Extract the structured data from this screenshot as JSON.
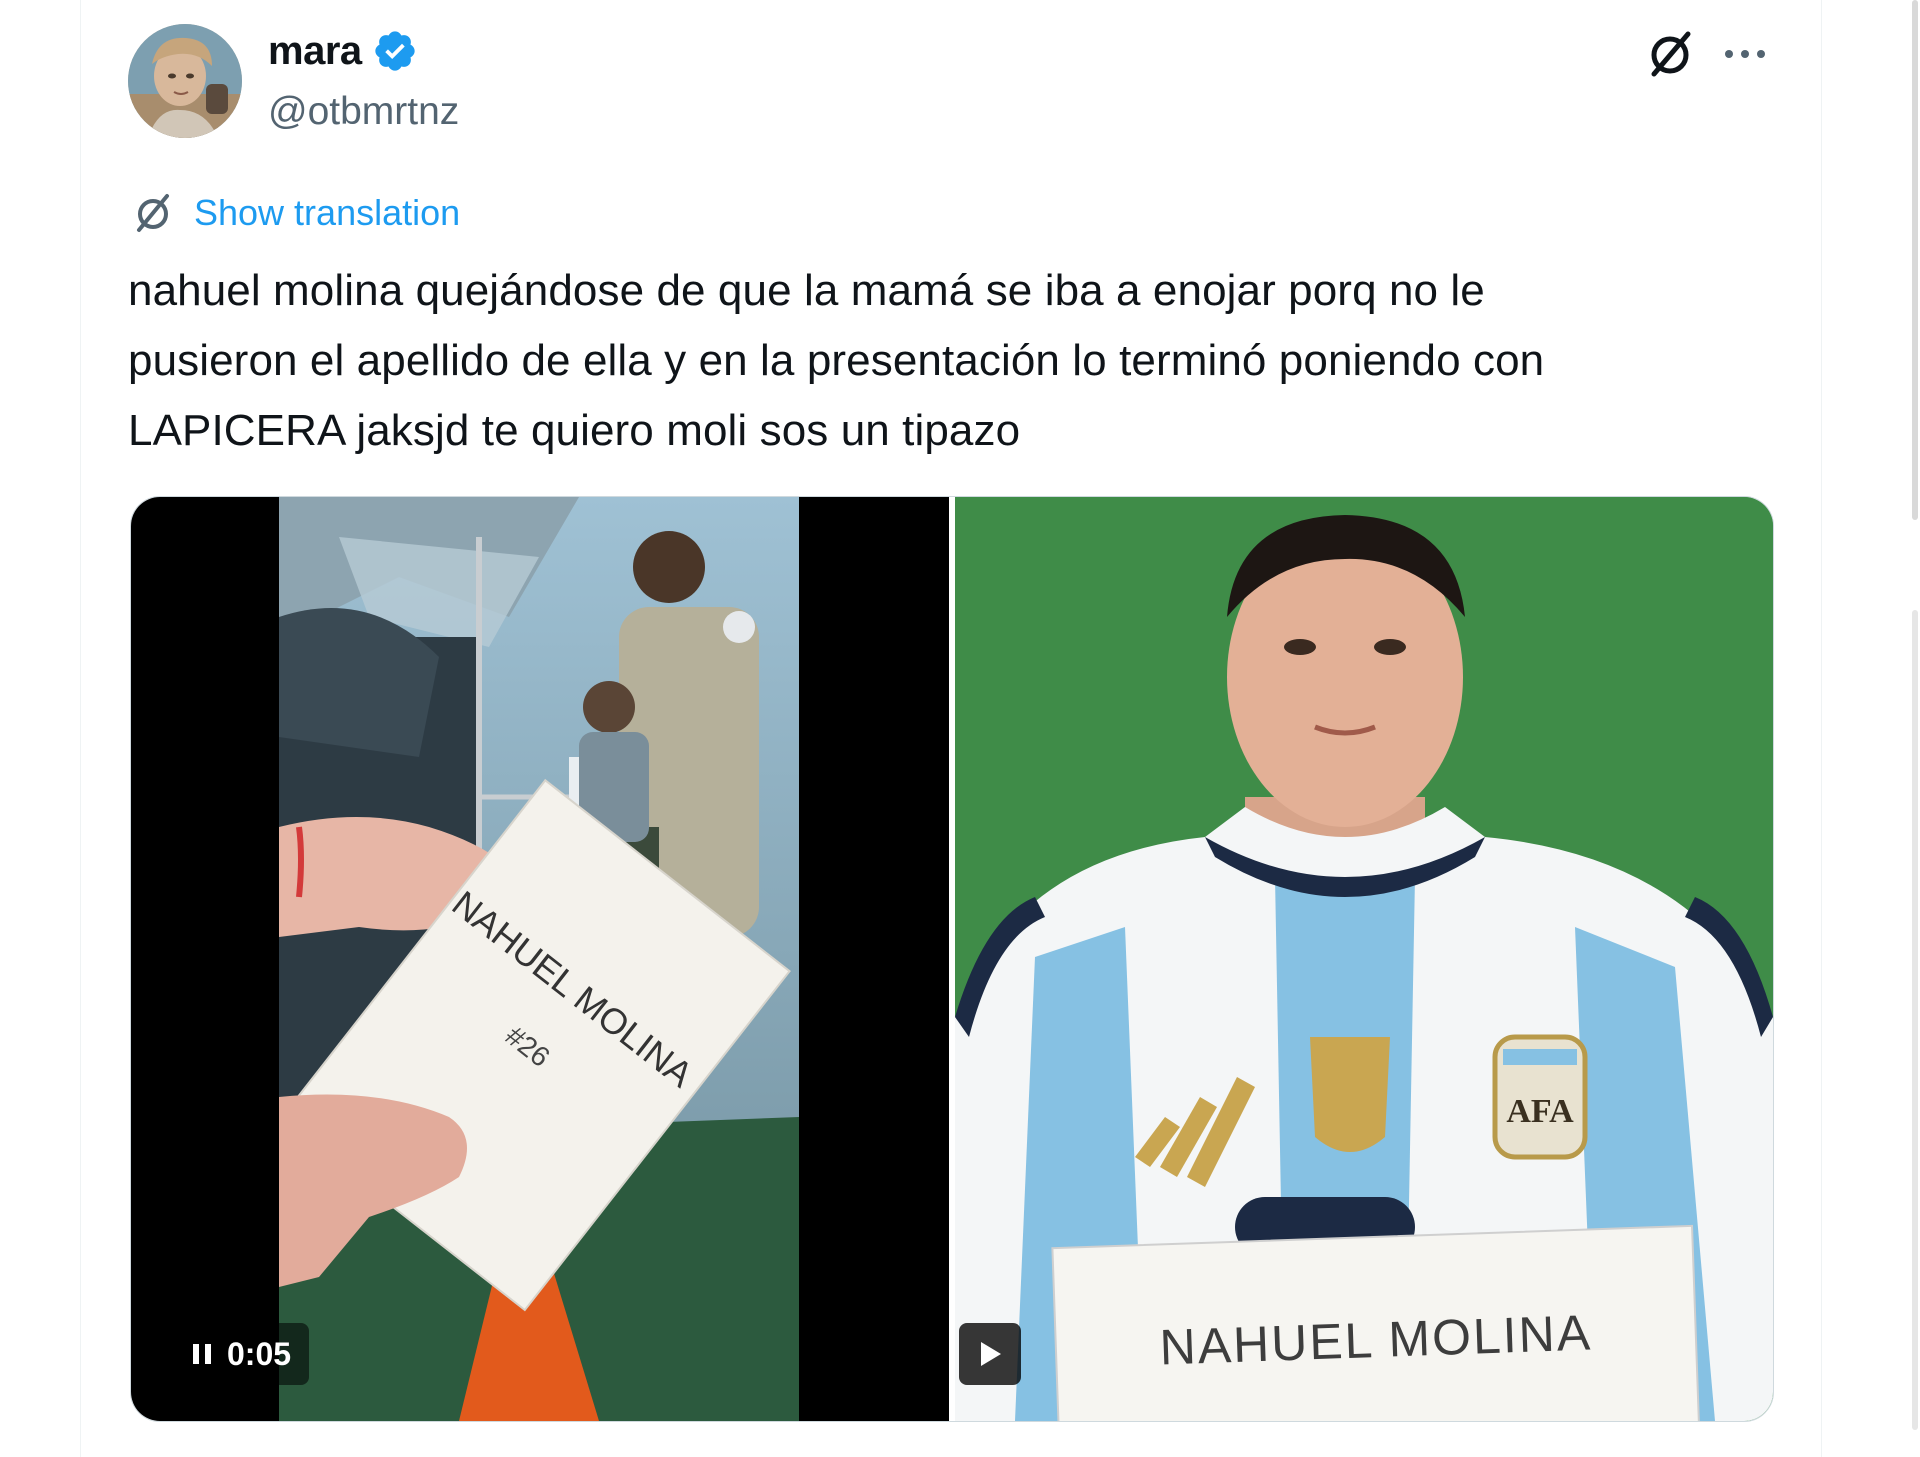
{
  "tweet": {
    "author": {
      "display_name": "mara",
      "handle": "@otbmrtnz",
      "verified": true
    },
    "translate_label": "Show translation",
    "text_lines": [
      "nahuel molina quejándose de que la mamá se iba a enojar porq no le",
      "pusieron el apellido de ella y en la presentación lo terminó poniendo con",
      "LAPICERA jaksjd te quiero moli sos un tipazo"
    ],
    "media": {
      "left": {
        "type": "video",
        "time": "0:05",
        "card_text": "NAHUEL MOLINA",
        "card_number": "#26",
        "state": "playing"
      },
      "right": {
        "type": "video",
        "sign_text": "NAHUEL MOLINA",
        "crest_text": "AFA",
        "state": "paused"
      }
    }
  },
  "colors": {
    "accent": "#1d9bf0",
    "text": "#0f1419",
    "secondary": "#536471",
    "green_screen": "#3f8c48"
  },
  "icons": {
    "verified": "verified-badge-icon",
    "grok": "grok-icon",
    "more": "more-dots-icon",
    "translate": "translate-icon",
    "pause": "pause-icon",
    "play": "play-icon"
  }
}
